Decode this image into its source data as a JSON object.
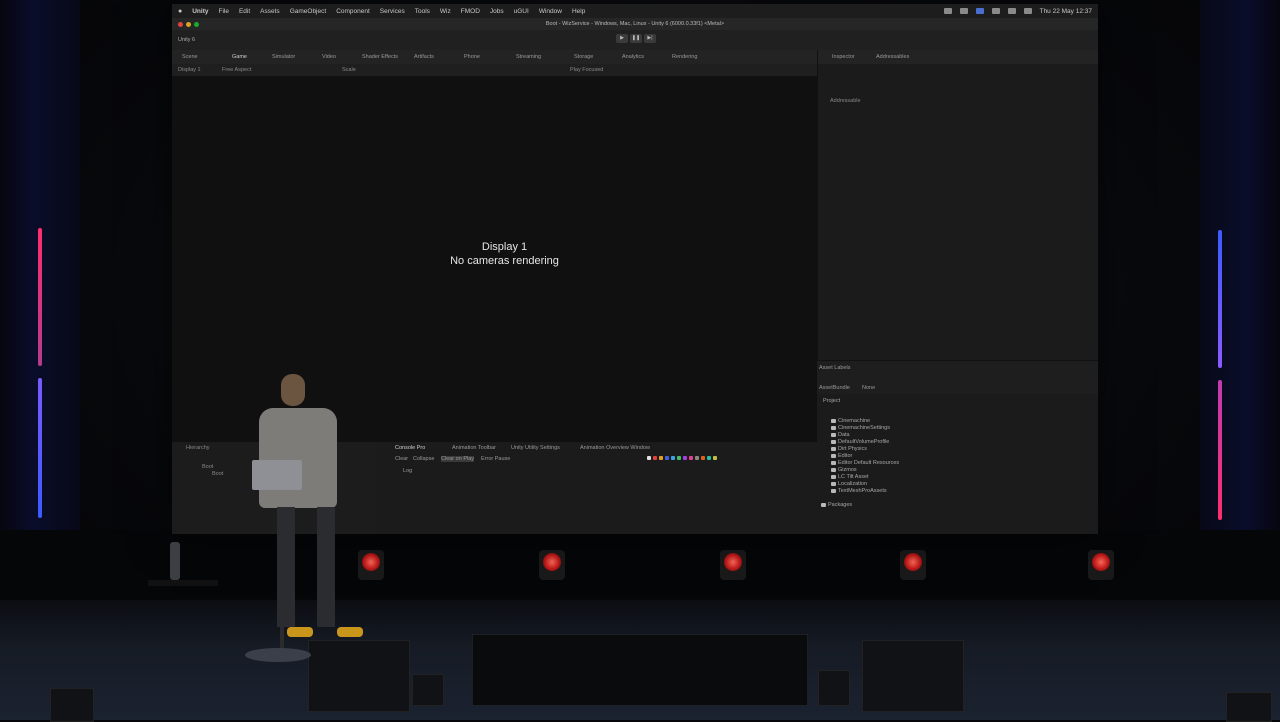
{
  "menubar": {
    "apple": "",
    "app": "Unity",
    "items": [
      "File",
      "Edit",
      "Assets",
      "GameObject",
      "Component",
      "Services",
      "Tools",
      "Wiz",
      "FMOD",
      "Jobs",
      "uGUI",
      "Window",
      "Help"
    ],
    "clock": "Thu 22 May 12:37"
  },
  "window": {
    "title": "Boot - WizService - Windows, Mac, Linux - Unity 6 (6000.0.33f1) <Metal>"
  },
  "toolbar": {
    "account": "Unity 6"
  },
  "game_tabs": {
    "scene": "Scene",
    "game": "Game",
    "other": [
      "Simulator",
      "Video",
      "Shader Effects",
      "Artifacts",
      "Phone",
      "Streaming",
      "Storage",
      "Analytics",
      "Rendering"
    ]
  },
  "game_sub": {
    "display": "Display 1",
    "aspect": "Free Aspect",
    "scale": "Scale",
    "play_focused": "Play Focused"
  },
  "game_view": {
    "display_label": "Display 1",
    "message": "No cameras rendering"
  },
  "inspector": {
    "tab": "Inspector",
    "tab2": "Addressables",
    "addressable": "Addressable"
  },
  "asset_labels": {
    "title": "Asset Labels",
    "bundle_label": "AssetBundle",
    "bundle_value": "None"
  },
  "project": {
    "tab": "Project",
    "folders": [
      "Cinemachine",
      "CinemachineSettings",
      "Data",
      "DefaultVolumeProfile",
      "Dirt Physics",
      "Editor",
      "Editor Default Resources",
      "Gizmos",
      "LC Tilt Asset",
      "Localization",
      "TextMeshProAssets",
      "Packages"
    ]
  },
  "hierarchy": {
    "tab": "Hierarchy",
    "root": "Boot",
    "child": "Boot"
  },
  "console": {
    "tabs": [
      "Console Pro",
      "Animation Toolbar",
      "Unity Utility Settings",
      "Animation Overview Window"
    ],
    "buttons": [
      "Clear",
      "Collapse",
      "Clear on Play",
      "Error Pause"
    ],
    "log": "Log"
  },
  "colors": {
    "screen_bg": "#1a1a1a",
    "led_pink": "#ff2d6e",
    "led_blue": "#3b5bff",
    "accent": "#4a6fd0"
  }
}
